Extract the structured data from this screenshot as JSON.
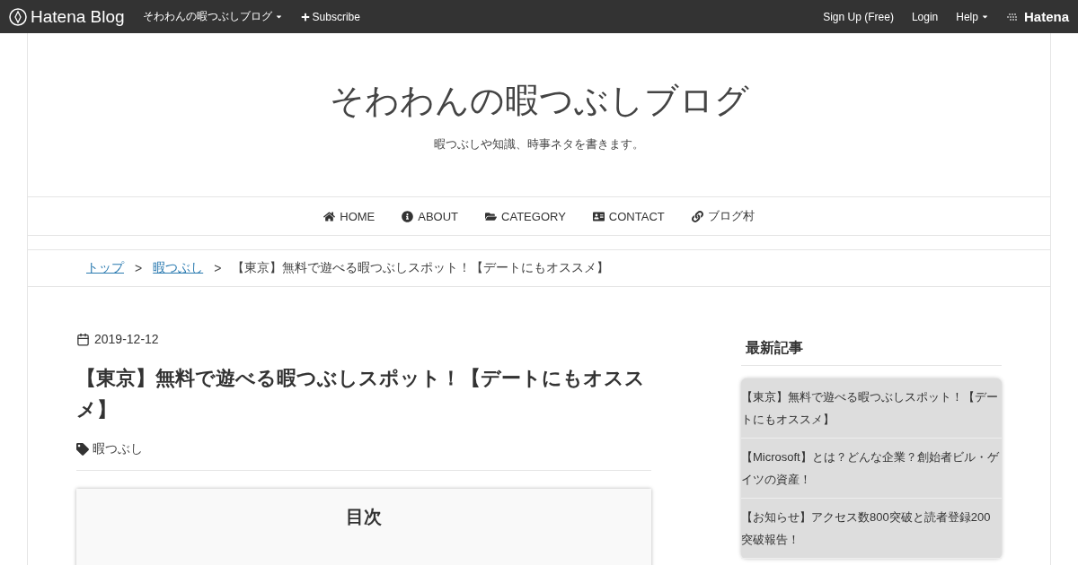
{
  "topbar": {
    "logo": "Hatena Blog",
    "blog_menu": "そわわんの暇つぶしブログ",
    "subscribe": "Subscribe",
    "signup": "Sign Up (Free)",
    "login": "Login",
    "help": "Help",
    "brand": "Hatena"
  },
  "header": {
    "title": "そわわんの暇つぶしブログ",
    "description": "暇つぶしや知識、時事ネタを書きます。"
  },
  "nav": [
    {
      "kind": "home",
      "label": "HOME"
    },
    {
      "kind": "about",
      "label": "ABOUT"
    },
    {
      "kind": "category",
      "label": "CATEGORY"
    },
    {
      "kind": "contact",
      "label": "CONTACT"
    },
    {
      "kind": "link",
      "label": "ブログ村"
    }
  ],
  "breadcrumb": [
    {
      "kind": "link",
      "label": "トップ"
    },
    {
      "kind": "separator",
      "label": ">"
    },
    {
      "kind": "link",
      "label": "暇つぶし"
    },
    {
      "kind": "separator",
      "label": ">"
    },
    {
      "kind": "current",
      "label": "【東京】無料で遊べる暇つぶしスポット！【デートにもオススメ】"
    }
  ],
  "article": {
    "date": "2019-12-12",
    "title": "【東京】無料で遊べる暇つぶしスポット！【デートにもオススメ】",
    "category": "暇つぶし",
    "toc_title": "目次"
  },
  "sidebar": {
    "title": "最新記事",
    "items": [
      "【東京】無料で遊べる暇つぶしスポット！【デートにもオススメ】",
      "【Microsoft】とは？どんな企業？創始者ビル・ゲイツの資産！",
      "【お知らせ】アクセス数800突破と読者登録200突破報告！"
    ]
  }
}
